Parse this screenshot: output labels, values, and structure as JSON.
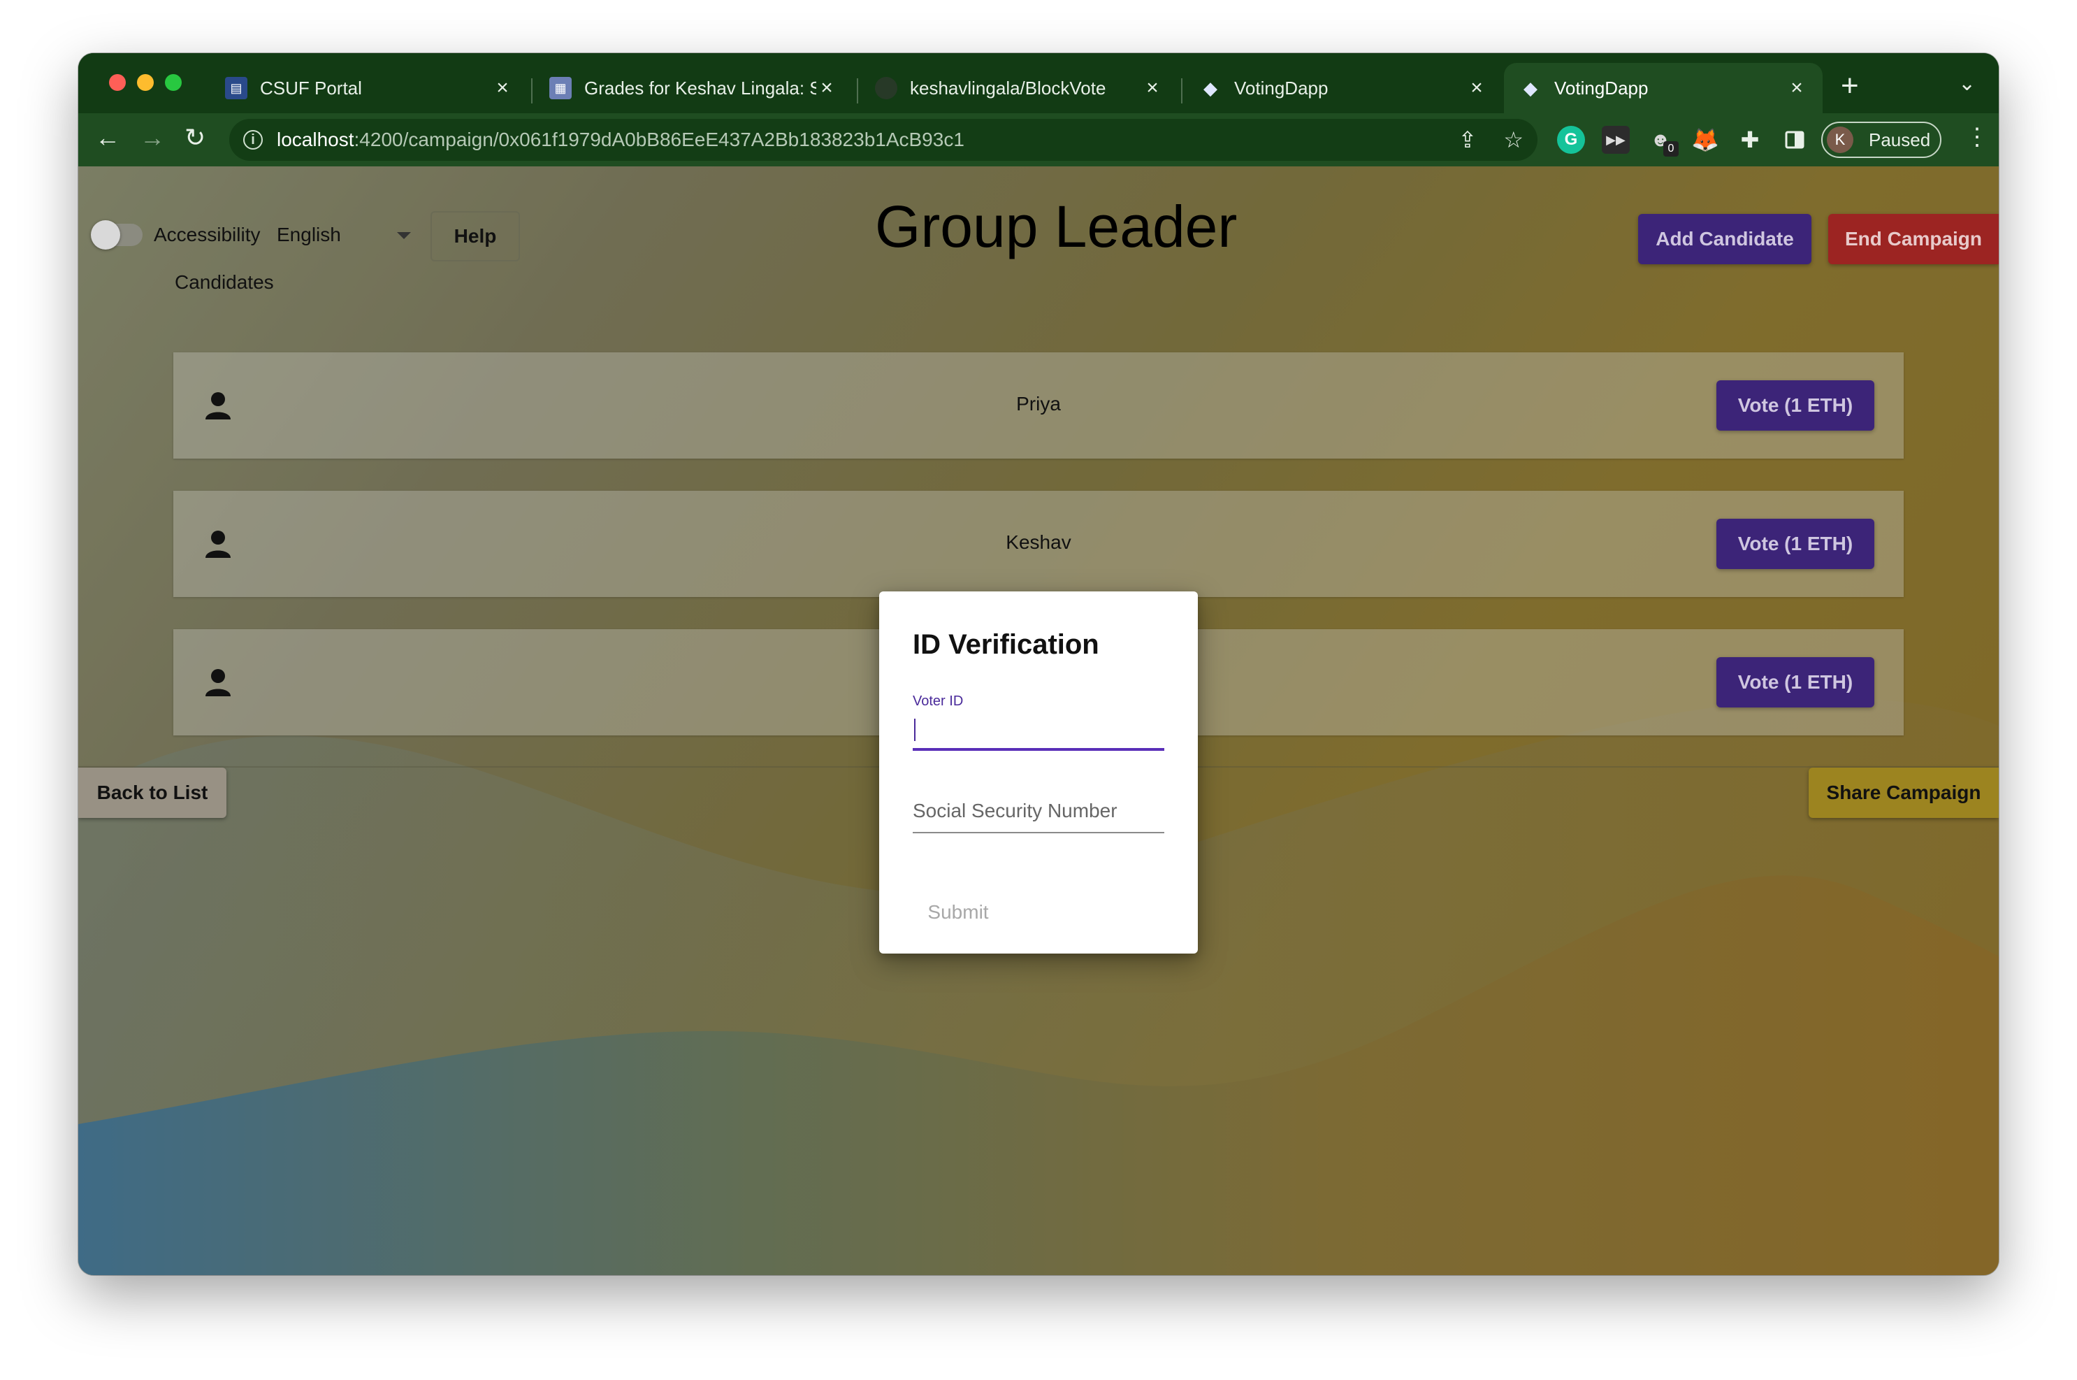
{
  "browser": {
    "tabs": [
      {
        "title": "CSUF Portal",
        "icon": "portal-favicon",
        "active": false
      },
      {
        "title": "Grades for Keshav Lingala: Sp",
        "icon": "canvas-favicon",
        "active": false
      },
      {
        "title": "keshavlingala/BlockVote",
        "icon": "github-favicon",
        "active": false
      },
      {
        "title": "VotingDapp",
        "icon": "ethereum-favicon",
        "active": false
      },
      {
        "title": "VotingDapp",
        "icon": "ethereum-favicon",
        "active": true
      }
    ],
    "close_glyph": "×",
    "new_tab_glyph": "+",
    "url_host": "localhost",
    "url_path": ":4200/campaign/0x061f1979dA0bB86EeE437A2Bb183823b1AcB93c1",
    "extension_badge": "0",
    "profile_initial": "K",
    "profile_label": "Paused"
  },
  "header": {
    "accessibility_label": "Accessibility",
    "language_value": "English",
    "help_label": "Help",
    "title": "Group Leader",
    "add_candidate_label": "Add Candidate",
    "end_campaign_label": "End Campaign"
  },
  "candidates": {
    "label": "Candidates",
    "items": [
      {
        "name": "Priya",
        "vote_label": "Vote (1 ETH)"
      },
      {
        "name": "Keshav",
        "vote_label": "Vote (1 ETH)"
      },
      {
        "name": "",
        "vote_label": "Vote (1 ETH)"
      }
    ]
  },
  "footer": {
    "back_label": "Back to List",
    "share_label": "Share Campaign"
  },
  "dialog": {
    "title": "ID Verification",
    "voter_id_label": "Voter ID",
    "voter_id_value": "",
    "ssn_placeholder": "Social Security Number",
    "submit_label": "Submit"
  },
  "colors": {
    "primary_purple": "#3c2478",
    "danger_red": "#9c2422",
    "share_yellow": "#9c8420",
    "browser_green": "#1f4d21"
  }
}
